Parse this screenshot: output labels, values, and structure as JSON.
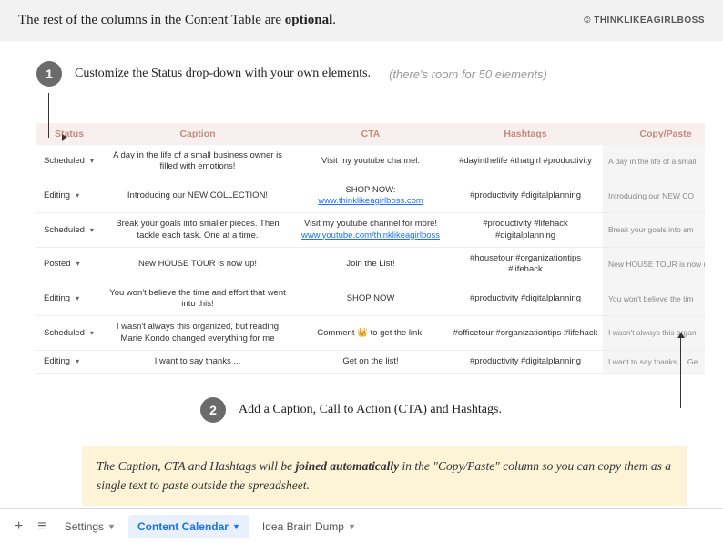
{
  "header": {
    "text_pre": "The rest of the columns in the Content Table are ",
    "text_bold": "optional",
    "text_post": ".",
    "copyright": "© THINKLIKEAGIRLBOSS"
  },
  "step1": {
    "num": "1",
    "text": "Customize the Status drop-down with your own elements.",
    "hint": "(there's room for 50 elements)"
  },
  "step2": {
    "num": "2",
    "text": "Add a Caption, Call to Action (CTA) and Hashtags."
  },
  "table": {
    "headers": [
      "Status",
      "Caption",
      "CTA",
      "Hashtags",
      "Copy/Paste"
    ],
    "rows": [
      {
        "status": "Scheduled",
        "caption": "A day in the life of a small business owner is filled with emotions!",
        "cta_text": "Visit my youtube channel:",
        "cta_link": "",
        "hashtags": "#dayinthelife #thatgirl #productivity",
        "copy": "A day in the life of a small"
      },
      {
        "status": "Editing",
        "caption": "Introducing our NEW COLLECTION!",
        "cta_text": "SHOP NOW:",
        "cta_link": "www.thinklikeagirlboss.com",
        "hashtags": "#productivity #digitalplanning",
        "copy": "Introducing our NEW CO"
      },
      {
        "status": "Scheduled",
        "caption": "Break your goals into smaller pieces. Then tackle each task. One at a time.",
        "cta_text": "Visit my youtube channel for more!",
        "cta_link": "www.youtube.com/thinklikeagirlboss",
        "hashtags": "#productivity #lifehack #digitalplanning",
        "copy": "Break your goals into sm"
      },
      {
        "status": "Posted",
        "caption": "New HOUSE TOUR is now up!",
        "cta_text": "Join the List!",
        "cta_link": "",
        "hashtags": "#housetour #organizationtips #lifehack",
        "copy": "New HOUSE TOUR is now u"
      },
      {
        "status": "Editing",
        "caption": "You won't believe the time and effort that went into this!",
        "cta_text": "SHOP NOW",
        "cta_link": "",
        "hashtags": "#productivity #digitalplanning",
        "copy": "You won't believe the tim"
      },
      {
        "status": "Scheduled",
        "caption": "I wasn't always this organized, but reading Marie Kondo changed everything for me",
        "cta_text": "Comment 👑  to get the link!",
        "cta_link": "",
        "hashtags": "#officetour #organizationtips #lifehack",
        "copy": "I wasn't always this organ"
      },
      {
        "status": "Editing",
        "caption": "I want to say thanks ...",
        "cta_text": "Get on the list!",
        "cta_link": "",
        "hashtags": "#productivity #digitalplanning",
        "copy": "I want to say thanks ...  Ge"
      }
    ]
  },
  "highlight": {
    "pre": "The Caption, CTA and Hashtags will be ",
    "bold": "joined automatically",
    "post": " in the \"Copy/Paste\" column so you can copy them as a single text to paste outside the spreadsheet."
  },
  "tabs": {
    "settings": "Settings",
    "calendar": "Content Calendar",
    "braindump": "Idea Brain Dump"
  }
}
